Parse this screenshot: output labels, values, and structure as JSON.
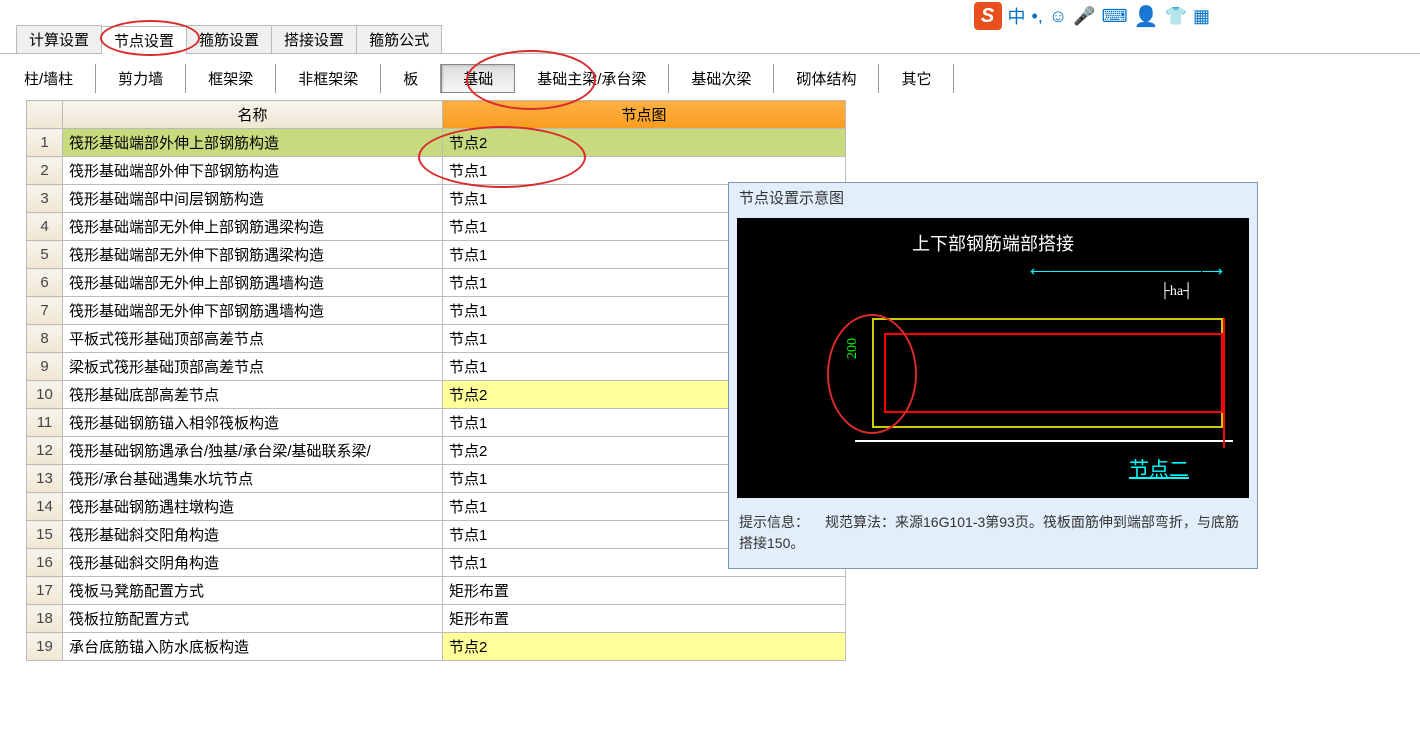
{
  "ime": {
    "logo": "S",
    "lang": "中"
  },
  "tabs": {
    "t0": "计算设置",
    "t1": "节点设置",
    "t2": "箍筋设置",
    "t3": "搭接设置",
    "t4": "箍筋公式"
  },
  "subtabs": {
    "s0": "柱/墙柱",
    "s1": "剪力墙",
    "s2": "框架梁",
    "s3": "非框架梁",
    "s4": "板",
    "s5": "基础",
    "s6": "基础主梁/承台梁",
    "s7": "基础次梁",
    "s8": "砌体结构",
    "s9": "其它"
  },
  "headers": {
    "name": "名称",
    "node": "节点图"
  },
  "rows": [
    {
      "n": 1,
      "name": "筏形基础端部外伸上部钢筋构造",
      "node": "节点2",
      "sel": true
    },
    {
      "n": 2,
      "name": "筏形基础端部外伸下部钢筋构造",
      "node": "节点1"
    },
    {
      "n": 3,
      "name": "筏形基础端部中间层钢筋构造",
      "node": "节点1"
    },
    {
      "n": 4,
      "name": "筏形基础端部无外伸上部钢筋遇梁构造",
      "node": "节点1"
    },
    {
      "n": 5,
      "name": "筏形基础端部无外伸下部钢筋遇梁构造",
      "node": "节点1"
    },
    {
      "n": 6,
      "name": "筏形基础端部无外伸上部钢筋遇墙构造",
      "node": "节点1"
    },
    {
      "n": 7,
      "name": "筏形基础端部无外伸下部钢筋遇墙构造",
      "node": "节点1"
    },
    {
      "n": 8,
      "name": "平板式筏形基础顶部高差节点",
      "node": "节点1"
    },
    {
      "n": 9,
      "name": "梁板式筏形基础顶部高差节点",
      "node": "节点1"
    },
    {
      "n": 10,
      "name": "筏形基础底部高差节点",
      "node": "节点2",
      "hl": true
    },
    {
      "n": 11,
      "name": "筏形基础钢筋锚入相邻筏板构造",
      "node": "节点1"
    },
    {
      "n": 12,
      "name": "筏形基础钢筋遇承台/独基/承台梁/基础联系梁/",
      "node": "节点2"
    },
    {
      "n": 13,
      "name": "筏形/承台基础遇集水坑节点",
      "node": "节点1"
    },
    {
      "n": 14,
      "name": "筏形基础钢筋遇柱墩构造",
      "node": "节点1"
    },
    {
      "n": 15,
      "name": "筏形基础斜交阳角构造",
      "node": "节点1"
    },
    {
      "n": 16,
      "name": "筏形基础斜交阴角构造",
      "node": "节点1"
    },
    {
      "n": 17,
      "name": "筏板马凳筋配置方式",
      "node": "矩形布置"
    },
    {
      "n": 18,
      "name": "筏板拉筋配置方式",
      "node": "矩形布置"
    },
    {
      "n": 19,
      "name": "承台底筋锚入防水底板构造",
      "node": "节点2",
      "hl": true
    }
  ],
  "panel": {
    "title": "节点设置示意图",
    "cad_title": "上下部钢筋端部搭接",
    "dim_ha": "ha",
    "dim_v": "200",
    "link": "节点二",
    "tip_label": "提示信息：",
    "tip_text": "规范算法：来源16G101-3第93页。筏板面筋伸到端部弯折，与底筋搭接150。"
  }
}
